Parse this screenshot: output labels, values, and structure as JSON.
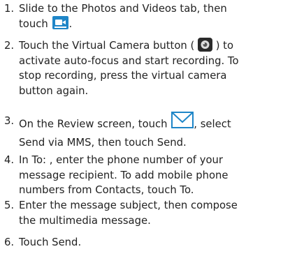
{
  "steps": [
    {
      "number": "1.",
      "line1": "Slide to the Photos and Videos tab, then",
      "line2_prefix": "touch",
      "line2_suffix": "."
    },
    {
      "number": "2.",
      "line1_prefix": "Touch the Virtual Camera button (",
      "line1_suffix": ") to",
      "line2": "activate auto-focus and start recording. To",
      "line3": "stop recording, press the virtual camera",
      "line4": "button again."
    },
    {
      "number": "3.",
      "line1_prefix": "On the Review screen, touch",
      "line1_suffix": ", select",
      "line2": "Send via MMS, then touch Send."
    },
    {
      "number": "4.",
      "line1": "In To: , enter the phone number of your",
      "line2": "message recipient. To add mobile phone",
      "line3": "numbers from Contacts, touch To."
    },
    {
      "number": "5.",
      "line1": "Enter the message subject, then compose",
      "line2": "the multimedia message."
    },
    {
      "number": "6.",
      "line1": "Touch Send."
    }
  ],
  "icons": {
    "video_tab": "video-camera-icon",
    "virtual_camera": "camera-shutter-icon",
    "send_message": "envelope-icon"
  },
  "colors": {
    "text": "#222222",
    "video_icon_bg": "#1f86c8",
    "camera_icon_bg": "#2b2b2b",
    "envelope_stroke": "#1f86c8"
  }
}
